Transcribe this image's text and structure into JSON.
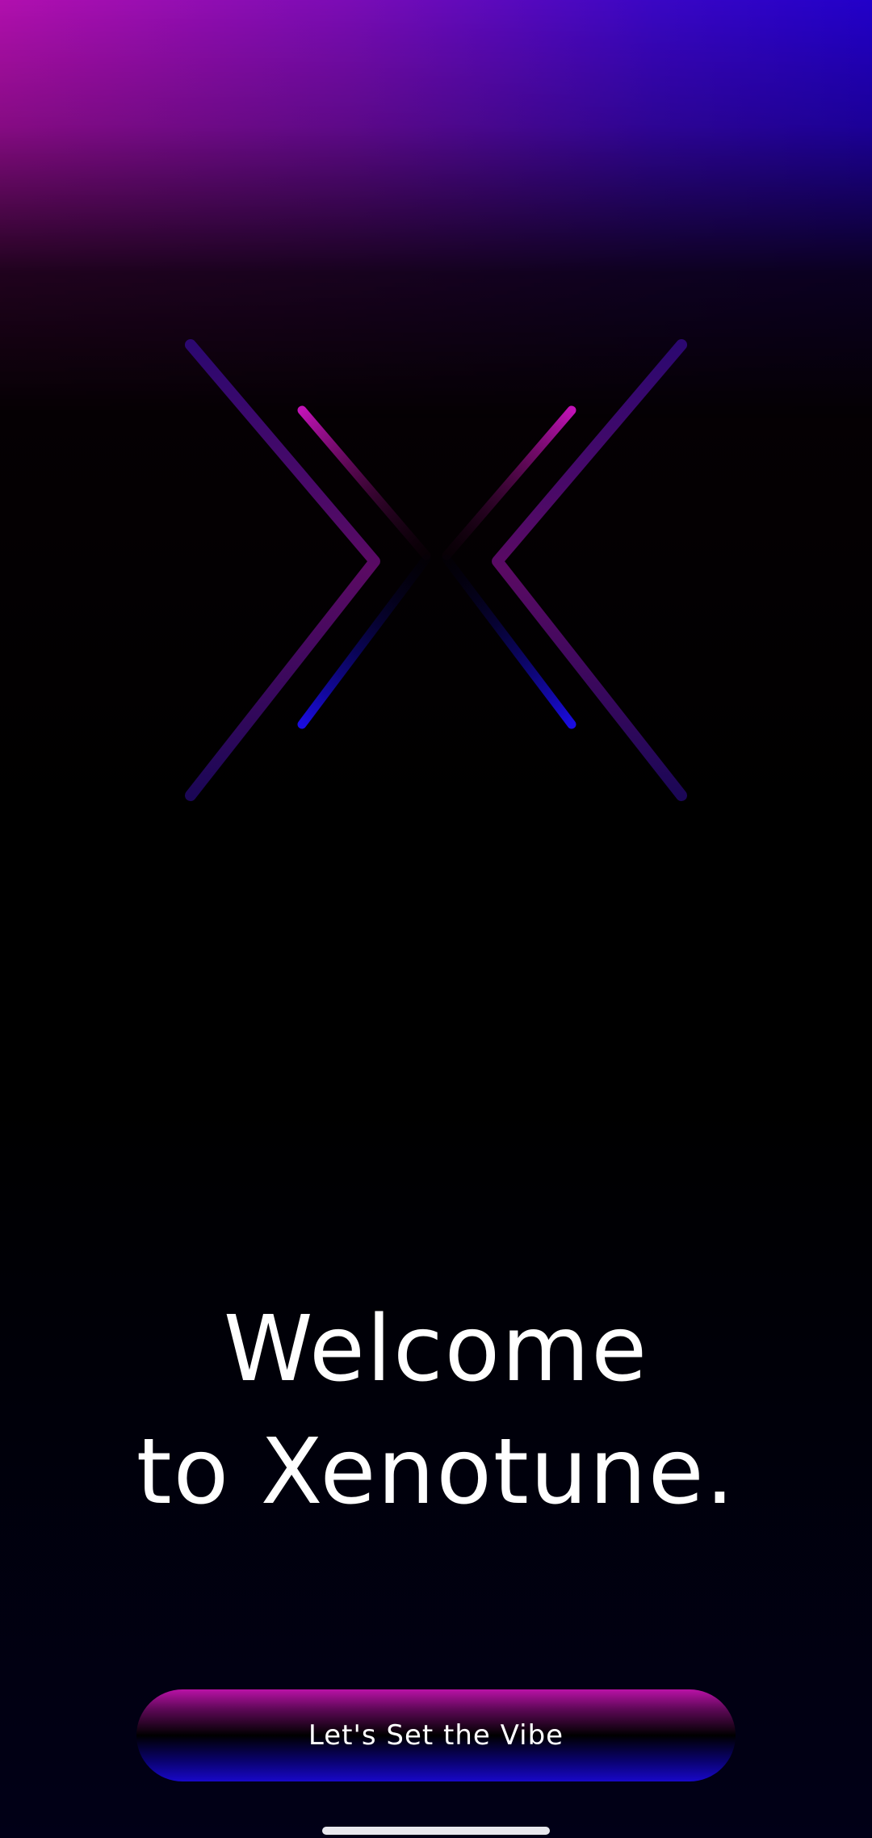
{
  "app": {
    "name": "Xenotune"
  },
  "welcome": {
    "line1": "Welcome",
    "line2": "to Xenotune."
  },
  "cta": {
    "label": "Let's Set the Vibe"
  },
  "logo": {
    "icon": "xenotune-x-logo-icon"
  },
  "colors": {
    "magenta": "#b10fae",
    "violet": "#3a06c4",
    "blue": "#1808c9",
    "background": "#000000",
    "text": "#ffffff"
  }
}
